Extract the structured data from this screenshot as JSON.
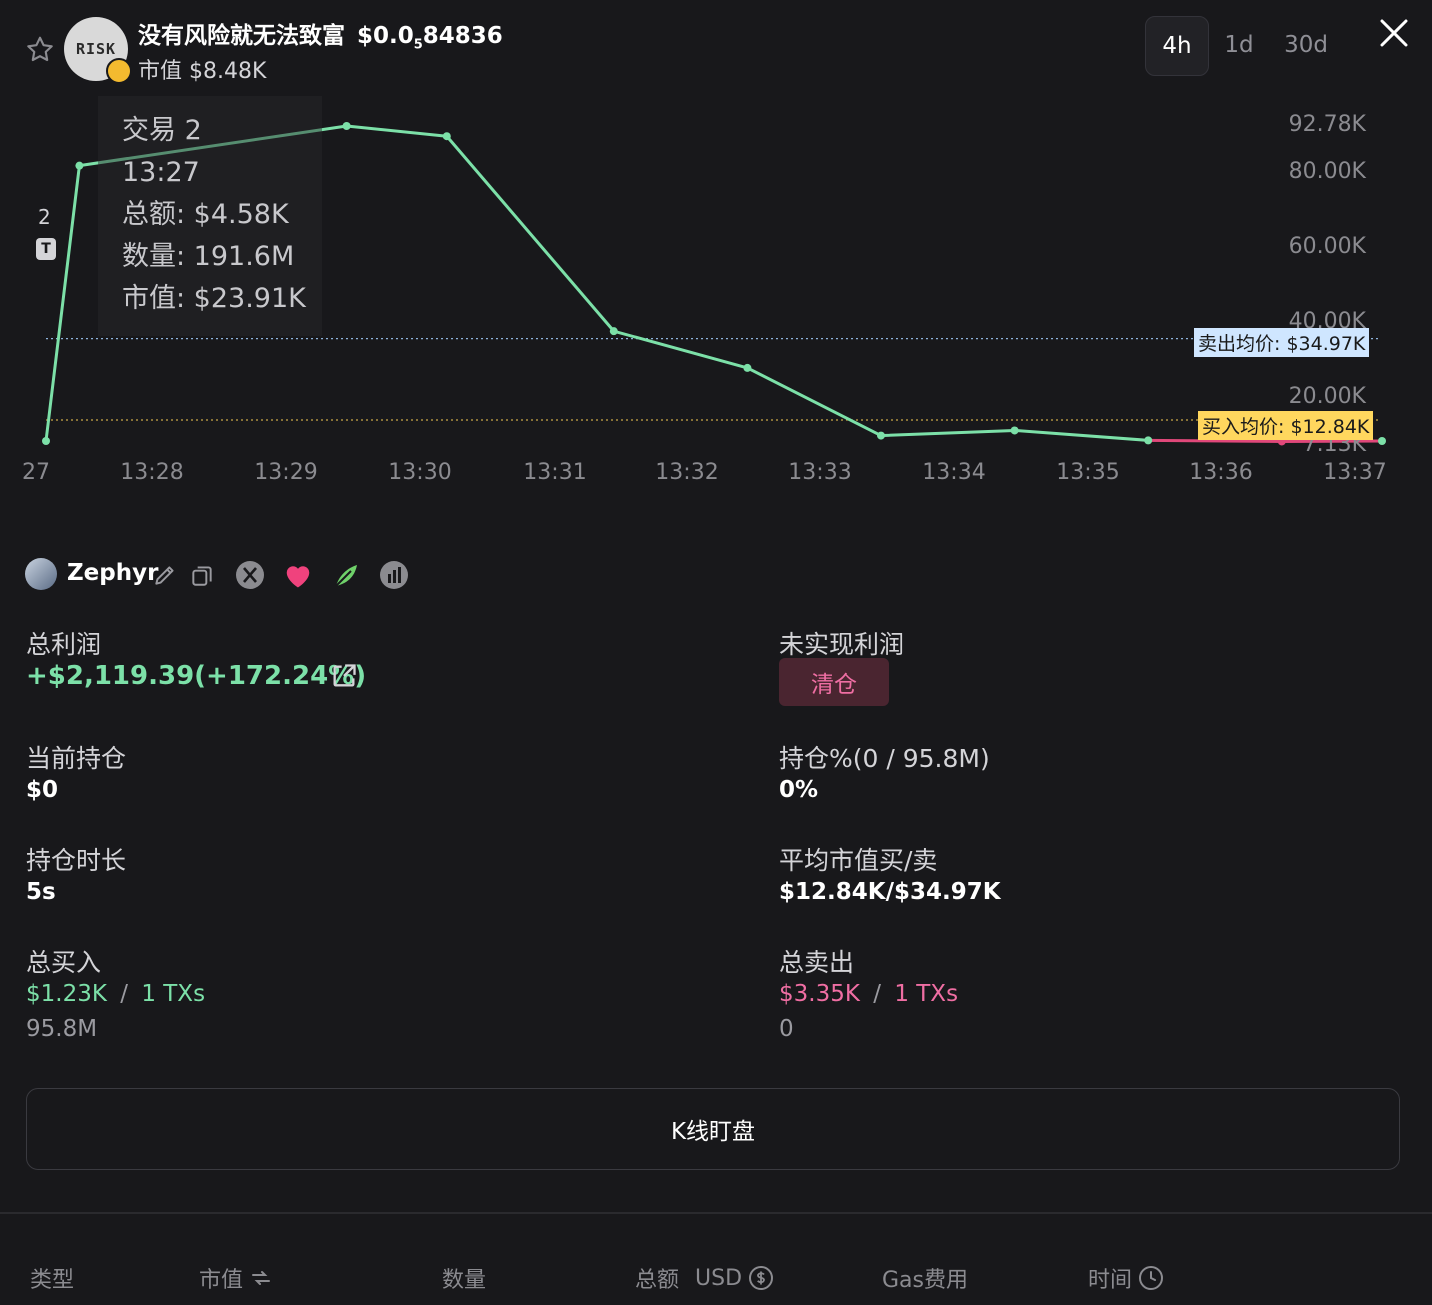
{
  "header": {
    "token_name": "没有风险就无法致富",
    "price_prefix": "$0.0",
    "price_subscript": "5",
    "price_digits": "84836",
    "market_cap": "市值 $8.48K",
    "avatar_text": "RISK",
    "timeframes": [
      "4h",
      "1d",
      "30d"
    ],
    "active_timeframe": "4h"
  },
  "chart_data": {
    "type": "line",
    "x": [
      "13:27:00",
      "13:27:15",
      "13:29:15",
      "13:30:00",
      "13:31:15",
      "13:32:15",
      "13:33:15",
      "13:34:15",
      "13:35:15",
      "13:36:15",
      "13:37:00"
    ],
    "values": [
      7130,
      82000,
      92780,
      90000,
      37000,
      27000,
      8600,
      10000,
      7300,
      7000,
      7130
    ],
    "sell_segment_from_index": 8,
    "ylim": [
      7130,
      92780
    ],
    "y_ticks": [
      "92.78K",
      "80.00K",
      "60.00K",
      "40.00K",
      "20.00K",
      "7.13K"
    ],
    "x_ticks": [
      "27",
      "13:28",
      "13:29",
      "13:30",
      "13:31",
      "13:32",
      "13:33",
      "13:34",
      "13:35",
      "13:36",
      "13:37"
    ],
    "sell_avg_line": {
      "value": 34970,
      "label": "卖出均价: $34.97K",
      "color": "#cfe6ff"
    },
    "buy_avg_line": {
      "value": 12840,
      "label": "买入均价: $12.84K",
      "color": "#ffd75e"
    },
    "line_color": "#7ce0a8",
    "sell_color": "#e0487a",
    "tooltip": {
      "title": "交易 2",
      "time": "13:27",
      "total": "总额: $4.58K",
      "quantity": "数量: 191.6M",
      "market_cap": "市值: $23.91K"
    },
    "marker": {
      "count": "2",
      "letter": "T"
    }
  },
  "user": {
    "name": "Zephyr",
    "icons": [
      "edit-icon",
      "copy-icon",
      "x-social-icon",
      "heart-icon",
      "leaf-icon",
      "chart-badge-icon"
    ]
  },
  "stats": {
    "total_profit_label": "总利润",
    "total_profit_value": "+$2,119.39(+172.24%)",
    "unrealized_label": "未实现利润",
    "clear_button": "清仓",
    "current_position_label": "当前持仓",
    "current_position_value": "$0",
    "position_pct_label": "持仓%(0 / 95.8M)",
    "position_pct_value": "0%",
    "hold_time_label": "持仓时长",
    "hold_time_value": "5s",
    "avg_mc_label": "平均市值买/卖",
    "avg_mc_value": "$12.84K/$34.97K",
    "total_buy_label": "总买入",
    "total_buy_amount": "$1.23K",
    "total_buy_sep": "/",
    "total_buy_txs": "1 TXs",
    "total_buy_qty": "95.8M",
    "total_sell_label": "总卖出",
    "total_sell_amount": "$3.35K",
    "total_sell_sep": "/",
    "total_sell_txs": "1 TXs",
    "total_sell_qty": "0"
  },
  "kline_button": "K线盯盘",
  "table_headers": {
    "type": "类型",
    "market_cap": "市值",
    "quantity": "数量",
    "total": "总额",
    "currency": "USD",
    "gas": "Gas费用",
    "time": "时间"
  }
}
